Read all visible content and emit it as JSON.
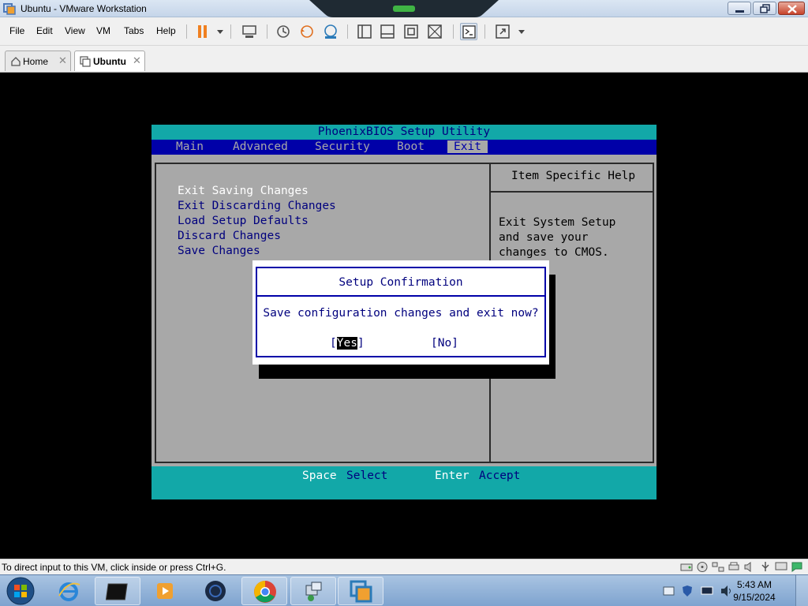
{
  "window": {
    "title": "Ubuntu - VMware Workstation"
  },
  "menubar": {
    "items": [
      "File",
      "Edit",
      "View",
      "VM",
      "Tabs",
      "Help"
    ]
  },
  "tabs": [
    {
      "label": "Home",
      "icon": "home-icon",
      "active": false
    },
    {
      "label": "Ubuntu",
      "icon": "vm-icon",
      "active": true
    }
  ],
  "bios": {
    "title": "PhoenixBIOS Setup Utility",
    "menus": [
      "Main",
      "Advanced",
      "Security",
      "Boot",
      "Exit"
    ],
    "active_menu": "Exit",
    "options": [
      "Exit Saving Changes",
      "Exit Discarding Changes",
      "Load Setup Defaults",
      "Discard Changes",
      "Save Changes"
    ],
    "selected_option": "Exit Saving Changes",
    "help_title": "Item Specific Help",
    "help_text": "Exit System Setup and save your changes to CMOS.",
    "footer": [
      {
        "key": "Space",
        "desc": "Select"
      },
      {
        "key": "Enter",
        "desc": "Accept"
      }
    ],
    "colors": {
      "cyan": "#12a8a8",
      "navy": "#0000a8",
      "gray": "#a8a8a8"
    }
  },
  "dialog": {
    "title": "Setup Confirmation",
    "message": "Save configuration changes and exit now?",
    "yes_open": "[",
    "yes_label": "Yes",
    "yes_close": "]",
    "no_label": "[No]",
    "selected": "Yes"
  },
  "statusbar": {
    "text": "To direct input to this VM, click inside or press Ctrl+G."
  },
  "taskbar": {
    "apps": [
      "internet-explorer-icon",
      "terminal-icon",
      "media-player-icon",
      "vmware-orb-icon",
      "chrome-icon",
      "network-tool-icon",
      "vmware-workstation-icon"
    ],
    "clock_time": "5:43 AM",
    "clock_date": "9/15/2024"
  }
}
